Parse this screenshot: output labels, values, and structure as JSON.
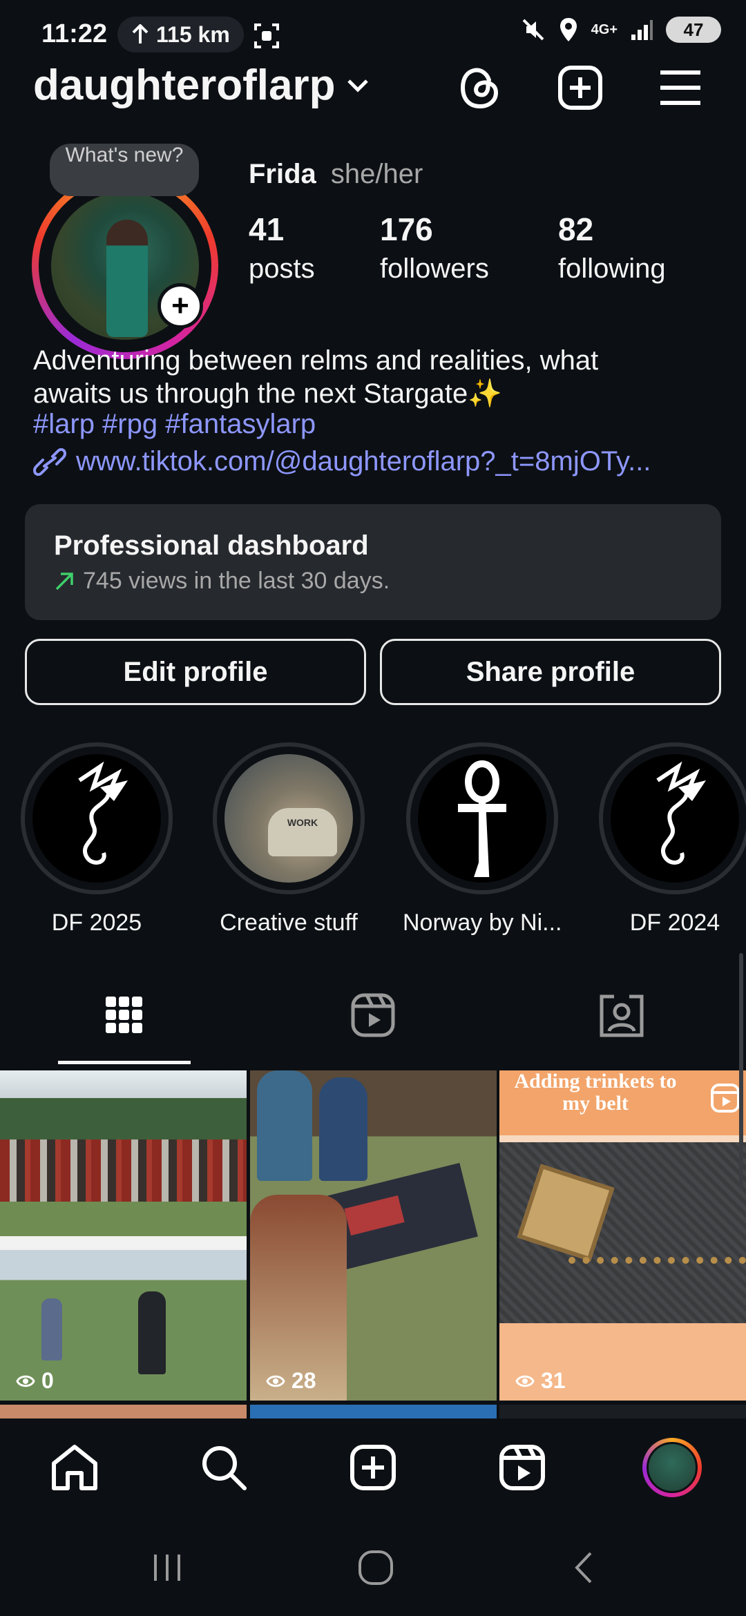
{
  "status_bar": {
    "time": "11:22",
    "speed": "115 km",
    "network": "4G+",
    "battery": "47"
  },
  "header": {
    "username": "daughteroflarp",
    "icons": [
      "chevron-down-icon",
      "threads-icon",
      "create-icon",
      "menu-icon"
    ]
  },
  "profile": {
    "note": "What's new?",
    "name": "Frida",
    "pronouns": "she/her",
    "stats": [
      {
        "value": "41",
        "label": "posts"
      },
      {
        "value": "176",
        "label": "followers"
      },
      {
        "value": "82",
        "label": "following"
      }
    ],
    "bio_line1": "Adventuring between relms and realities, what",
    "bio_line2": "awaits us through the next Stargate✨",
    "hashtags": "#larp #rpg #fantasylarp",
    "link": "www.tiktok.com/@daughteroflarp?_t=8mjOTy..."
  },
  "dashboard": {
    "title": "Professional dashboard",
    "subtitle": "745 views in the last 30 days."
  },
  "buttons": {
    "edit": "Edit profile",
    "share": "Share profile"
  },
  "highlights": [
    {
      "label": "DF 2025"
    },
    {
      "label": "Creative stuff"
    },
    {
      "label": "Norway by Ni..."
    },
    {
      "label": "DF 2024"
    }
  ],
  "posts": [
    {
      "views": "0"
    },
    {
      "views": "28"
    },
    {
      "views": "31",
      "caption": "Adding trinkets to my belt"
    }
  ],
  "colors": {
    "background": "#0c1014",
    "link": "#8e97ff",
    "card": "#26292e",
    "trend": "#3ecf6a"
  }
}
